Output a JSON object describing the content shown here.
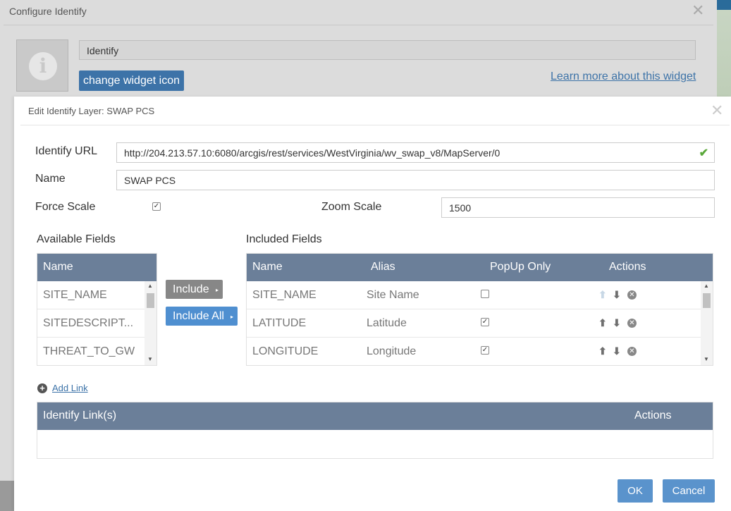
{
  "outer_dialog": {
    "title": "Configure Identify",
    "close_glyph": "✕",
    "widget_icon": "info-icon",
    "widget_name": "Identify",
    "change_icon_label": "change widget icon",
    "learn_more_label": "Learn more about this widget"
  },
  "inner_dialog": {
    "title": "Edit Identify Layer: SWAP PCS",
    "close_glyph": "✕",
    "identify_url_label": "Identify URL",
    "identify_url_value": "http://204.213.57.10:6080/arcgis/rest/services/WestVirginia/wv_swap_v8/MapServer/0",
    "url_valid_icon": "checkmark-icon",
    "name_label": "Name",
    "name_value": "SWAP PCS",
    "force_scale_label": "Force Scale",
    "force_scale_checked": true,
    "zoom_scale_label": "Zoom Scale",
    "zoom_scale_value": "1500"
  },
  "available_fields": {
    "title": "Available Fields",
    "header": "Name",
    "rows": [
      "SITE_NAME",
      "SITEDESCRIPT...",
      "THREAT_TO_GW"
    ]
  },
  "include_buttons": {
    "include": "Include",
    "include_all": "Include All"
  },
  "included_fields": {
    "title": "Included Fields",
    "headers": [
      "Name",
      "Alias",
      "PopUp Only",
      "Actions"
    ],
    "rows": [
      {
        "name": "SITE_NAME",
        "alias": "Site Name",
        "popup_only": false
      },
      {
        "name": "LATITUDE",
        "alias": "Latitude",
        "popup_only": true
      },
      {
        "name": "LONGITUDE",
        "alias": "Longitude",
        "popup_only": true
      }
    ]
  },
  "links": {
    "add_link_label": "Add Link",
    "header_title": "Identify Link(s)",
    "header_actions": "Actions"
  },
  "footer": {
    "ok_label": "OK",
    "cancel_label": "Cancel"
  },
  "colors": {
    "header_bg": "#6b7f99",
    "primary_button": "#5a93cc",
    "link": "#3d73a8"
  }
}
